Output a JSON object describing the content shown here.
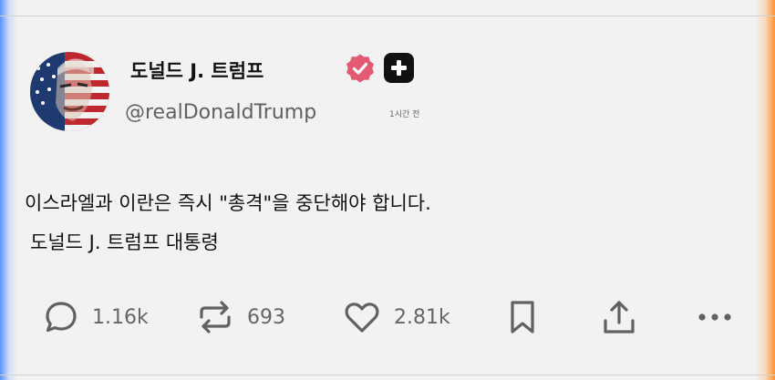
{
  "post": {
    "author": {
      "display_name": "도널드 J. 트럼프",
      "handle": "@realDonaldTrump",
      "avatar_icon": "flag-portrait-avatar"
    },
    "timestamp": "1시간 전",
    "body_lines": [
      "이스라엘과 이란은 즉시 \"총격\"을 중단해야 합니다.",
      "도널드 J. 트럼프 대통령"
    ]
  },
  "actions": {
    "replies": "1.16k",
    "reposts": "693",
    "likes": "2.81k"
  },
  "icons": {
    "verified": "verified-badge-icon",
    "add": "plus-icon",
    "reply": "comment-icon",
    "repost": "repost-icon",
    "like": "heart-icon",
    "bookmark": "bookmark-icon",
    "share": "share-icon",
    "more": "more-icon"
  },
  "colors": {
    "background": "#f2f2f2",
    "verified_badge": "#e55a73",
    "add_button": "#111111",
    "icon_gray": "#616161",
    "count_gray": "#666666",
    "left_edge_glow": "#508cff",
    "right_edge_glow": "#ff8c28"
  }
}
